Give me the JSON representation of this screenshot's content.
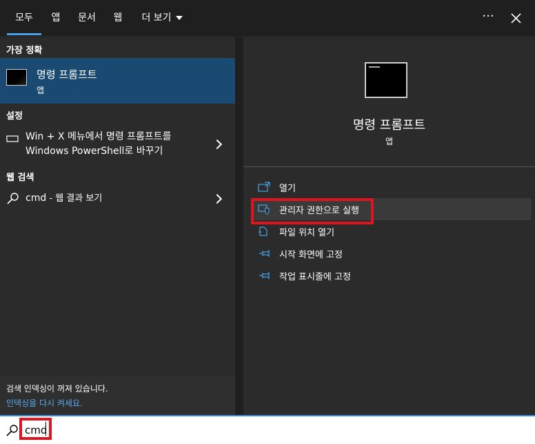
{
  "tabs": [
    "모두",
    "앱",
    "문서",
    "웹",
    "더 보기"
  ],
  "top_actions": {
    "more": "···"
  },
  "left": {
    "best_match_header": "가장 정확",
    "best_match": {
      "title": "명령 프롬프트",
      "subtitle": "앱"
    },
    "settings_header": "설정",
    "settings_item": {
      "line1": "Win + X 메뉴에서 명령 프롬프트를",
      "line2": "Windows PowerShell로 바꾸기"
    },
    "web_header": "웹 검색",
    "web_item": {
      "query": "cmd",
      "suffix": " - 웹 결과 보기"
    },
    "footer": {
      "status": "검색 인덱싱이 꺼져 있습니다.",
      "link": "인덱싱을 다시 켜세요."
    }
  },
  "right": {
    "app_title": "명령 프롬프트",
    "app_subtitle": "앱",
    "actions": [
      {
        "label": "열기",
        "icon": "open-icon"
      },
      {
        "label": "관리자 권한으로 실행",
        "icon": "shield-icon"
      },
      {
        "label": "파일 위치 열기",
        "icon": "file-location-icon"
      },
      {
        "label": "시작 화면에 고정",
        "icon": "pin-icon"
      },
      {
        "label": "작업 표시줄에 고정",
        "icon": "pin-icon"
      }
    ]
  },
  "search": {
    "value": "cmd"
  },
  "colors": {
    "accent": "#4aa0e6",
    "selected": "#1a4a72",
    "highlight_box": "#e0141e",
    "link": "#5aa9ef"
  }
}
